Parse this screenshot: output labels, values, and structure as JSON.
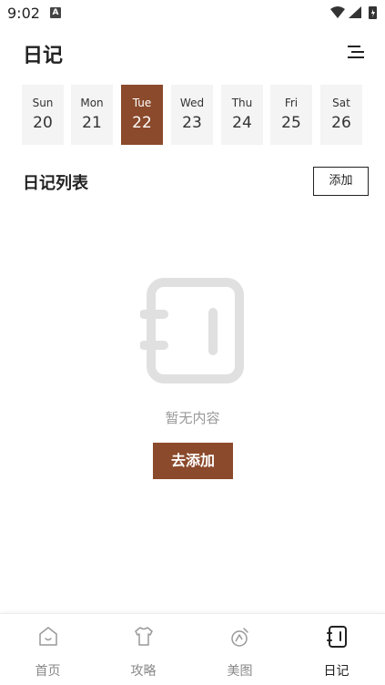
{
  "status_bar": {
    "time": "9:02",
    "notification_glyph": "A"
  },
  "header": {
    "title": "日记",
    "menu_icon": "filter-lines-icon"
  },
  "week": {
    "selected_index": 2,
    "days": [
      {
        "name": "Sun",
        "date": "20"
      },
      {
        "name": "Mon",
        "date": "21"
      },
      {
        "name": "Tue",
        "date": "22"
      },
      {
        "name": "Wed",
        "date": "23"
      },
      {
        "name": "Thu",
        "date": "24"
      },
      {
        "name": "Fri",
        "date": "25"
      },
      {
        "name": "Sat",
        "date": "26"
      }
    ]
  },
  "diary_list": {
    "title": "日记列表",
    "add_label": "添加",
    "empty_text": "暂无内容",
    "go_add_label": "去添加"
  },
  "tabs": [
    {
      "label": "首页",
      "icon": "home-icon"
    },
    {
      "label": "攻略",
      "icon": "shirt-icon"
    },
    {
      "label": "美图",
      "icon": "gallery-icon"
    },
    {
      "label": "日记",
      "icon": "diary-icon"
    }
  ],
  "active_tab": 3,
  "colors": {
    "accent": "#8b4a2b",
    "tile_bg": "#f4f4f4",
    "empty_icon": "#e0e0e0"
  }
}
